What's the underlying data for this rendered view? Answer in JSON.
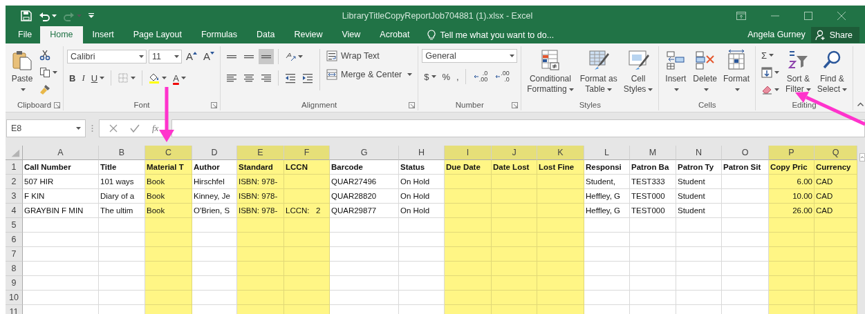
{
  "title_bar": {
    "title": "LibraryTitleCopyReportJob704881 (1).xlsx - Excel",
    "redo_disabled": true
  },
  "tabs": [
    {
      "label": "File",
      "selected": false
    },
    {
      "label": "Home",
      "selected": true
    },
    {
      "label": "Insert",
      "selected": false
    },
    {
      "label": "Page Layout",
      "selected": false
    },
    {
      "label": "Formulas",
      "selected": false
    },
    {
      "label": "Data",
      "selected": false
    },
    {
      "label": "Review",
      "selected": false
    },
    {
      "label": "View",
      "selected": false
    },
    {
      "label": "Acrobat",
      "selected": false
    }
  ],
  "tell_me": {
    "placeholder": "Tell me what you want to do..."
  },
  "user": "Angela Gurney",
  "share": "Share",
  "ribbon": {
    "groups": [
      {
        "label": "Clipboard",
        "launcher": true,
        "items": [
          {
            "kind": "large",
            "lines": [
              "Paste"
            ],
            "dropdown": true
          },
          {
            "kind": "stack",
            "items": [
              {
                "kind": "small",
                "dropdown": false
              },
              {
                "kind": "small",
                "dropdown": true
              },
              {
                "kind": "small",
                "dropdown": false
              }
            ]
          }
        ]
      },
      {
        "label": "Font",
        "launcher": true,
        "items": [
          {
            "kind": "rows",
            "lines": [
              {
                "items": [
                  {
                    "kind": "font-combo",
                    "value": "Calibri"
                  },
                  {
                    "kind": "size-combo",
                    "value": "11"
                  },
                  {
                    "kind": "grow",
                    "text": "A"
                  },
                  {
                    "kind": "shrink",
                    "text": "A"
                  }
                ]
              },
              {
                "items": [
                  {
                    "kind": "bold",
                    "text": "B",
                    "dropdown": false
                  },
                  {
                    "kind": "italic",
                    "text": "I",
                    "dropdown": false
                  },
                  {
                    "kind": "underline",
                    "text": "U",
                    "dropdown": true
                  },
                  {
                    "kind": "separator"
                  },
                  {
                    "kind": "small",
                    "dropdown": true
                  },
                  {
                    "kind": "separator"
                  },
                  {
                    "kind": "small",
                    "dropdown": true
                  },
                  {
                    "kind": "font-color",
                    "text": "A",
                    "dropdown": true
                  }
                ]
              }
            ]
          }
        ]
      },
      {
        "label": "Alignment",
        "launcher": true,
        "items": [
          {
            "kind": "rows",
            "lines": [
              {
                "items": [
                  {
                    "kind": "small",
                    "dropdown": false,
                    "selected": false
                  },
                  {
                    "kind": "small",
                    "dropdown": false,
                    "selected": false
                  },
                  {
                    "kind": "small",
                    "dropdown": false,
                    "selected": true
                  },
                  {
                    "kind": "separator"
                  },
                  {
                    "kind": "small",
                    "dropdown": true
                  }
                ]
              },
              {
                "items": [
                  {
                    "kind": "small",
                    "dropdown": false,
                    "selected": false
                  },
                  {
                    "kind": "small",
                    "dropdown": false,
                    "selected": false
                  },
                  {
                    "kind": "small",
                    "dropdown": false,
                    "selected": false
                  },
                  {
                    "kind": "separator"
                  },
                  {
                    "kind": "small",
                    "dropdown": false
                  },
                  {
                    "kind": "small",
                    "dropdown": false
                  }
                ]
              }
            ]
          },
          {
            "kind": "separator"
          },
          {
            "kind": "stack",
            "items": [
              {
                "kind": "text-button",
                "text": "Wrap Text",
                "dropdown": false
              },
              {
                "kind": "text-button",
                "text": "Merge & Center",
                "dropdown": true
              }
            ]
          }
        ]
      },
      {
        "label": "Number",
        "launcher": true,
        "items": [
          {
            "kind": "rows",
            "lines": [
              {
                "items": [
                  {
                    "kind": "format-combo",
                    "value": "General"
                  }
                ]
              },
              {
                "items": [
                  {
                    "kind": "text",
                    "text": "$",
                    "dropdown": true
                  },
                  {
                    "kind": "text",
                    "text": "%",
                    "dropdown": false
                  },
                  {
                    "kind": "text",
                    "text": ",",
                    "dropdown": false
                  },
                  {
                    "kind": "separator"
                  },
                  {
                    "kind": "decimal",
                    "lines": [
                      ".0",
                      ".00"
                    ]
                  },
                  {
                    "kind": "decimal",
                    "lines": [
                      ".00",
                      ".0"
                    ]
                  }
                ]
              }
            ]
          }
        ]
      },
      {
        "label": "Styles",
        "launcher": false,
        "items": [
          {
            "kind": "large",
            "lines": [
              "Conditional",
              "Formatting"
            ],
            "dropdown": true
          },
          {
            "kind": "large",
            "lines": [
              "Format as",
              "Table"
            ],
            "dropdown": true
          },
          {
            "kind": "large",
            "lines": [
              "Cell",
              "Styles"
            ],
            "dropdown": true
          }
        ]
      },
      {
        "label": "Cells",
        "launcher": false,
        "items": [
          {
            "kind": "large",
            "lines": [
              "Insert"
            ],
            "dropdown": true
          },
          {
            "kind": "large",
            "lines": [
              "Delete"
            ],
            "dropdown": true
          },
          {
            "kind": "large",
            "lines": [
              "Format"
            ],
            "dropdown": true
          }
        ]
      },
      {
        "label": "Editing",
        "launcher": false,
        "items": [
          {
            "kind": "stack",
            "items": [
              {
                "kind": "text",
                "text": "Σ",
                "dropdown": true
              },
              {
                "kind": "small",
                "dropdown": true
              },
              {
                "kind": "small",
                "dropdown": true
              }
            ]
          },
          {
            "kind": "large",
            "lines": [
              "Sort &",
              "Filter"
            ],
            "dropdown": true
          },
          {
            "kind": "large",
            "lines": [
              "Find &",
              "Select"
            ],
            "dropdown": true
          }
        ]
      }
    ]
  },
  "formula_bar": {
    "name_box": "E8",
    "function_label": "fx"
  },
  "sheet": {
    "columns": [
      {
        "letter": "A",
        "highlighted": false
      },
      {
        "letter": "B",
        "highlighted": false
      },
      {
        "letter": "C",
        "highlighted": true
      },
      {
        "letter": "D",
        "highlighted": false
      },
      {
        "letter": "E",
        "highlighted": true
      },
      {
        "letter": "F",
        "highlighted": true
      },
      {
        "letter": "G",
        "highlighted": false
      },
      {
        "letter": "H",
        "highlighted": false
      },
      {
        "letter": "I",
        "highlighted": true
      },
      {
        "letter": "J",
        "highlighted": true
      },
      {
        "letter": "K",
        "highlighted": true
      },
      {
        "letter": "L",
        "highlighted": false
      },
      {
        "letter": "M",
        "highlighted": false
      },
      {
        "letter": "N",
        "highlighted": false
      },
      {
        "letter": "O",
        "highlighted": false
      },
      {
        "letter": "P",
        "highlighted": true,
        "numeric": true
      },
      {
        "letter": "Q",
        "highlighted": true
      }
    ],
    "rows": [
      {
        "number": "1",
        "header": true,
        "cells": {
          "A": "Call Number",
          "B": "Title",
          "C": "Material T",
          "D": "Author",
          "E": "Standard",
          "F": "LCCN",
          "G": "Barcode",
          "H": "Status",
          "I": "Due Date",
          "J": "Date Lost",
          "K": "Lost Fine",
          "L": "Responsi",
          "M": "Patron Ba",
          "N": "Patron Ty",
          "O": "Patron Sit",
          "P": "Copy Pric",
          "Q": "Currency"
        }
      },
      {
        "number": "2",
        "header": false,
        "cells": {
          "A": "507 HIR",
          "B": "101 ways",
          "C": "Book",
          "D": "Hirschfel",
          "E": "ISBN: 978-",
          "G": "QUAR27496",
          "H": "On Hold",
          "L": "Student,",
          "M": "TEST333",
          "N": "Student",
          "P": "6.00",
          "Q": "CAD"
        }
      },
      {
        "number": "3",
        "header": false,
        "cells": {
          "A": "F KIN",
          "B": "Diary of a",
          "C": "Book",
          "D": "Kinney, Je",
          "E": "ISBN: 978-",
          "G": "QUAR28820",
          "H": "On Hold",
          "L": "Heffley, G",
          "M": "TEST000",
          "N": "Student",
          "P": "10.00",
          "Q": "CAD"
        }
      },
      {
        "number": "4",
        "header": false,
        "cells": {
          "A": "GRAYBIN F MIN",
          "B": "The ultim",
          "C": "Book",
          "D": "O'Brien, S",
          "E": "ISBN: 978-",
          "F": "LCCN:   2",
          "G": "QUAR29877",
          "H": "On Hold",
          "L": "Heffley, G",
          "M": "TEST000",
          "N": "Student",
          "P": "26.00",
          "Q": "CAD"
        }
      },
      {
        "number": "5",
        "header": false
      },
      {
        "number": "6",
        "header": false
      },
      {
        "number": "7",
        "header": false
      },
      {
        "number": "8",
        "header": false
      },
      {
        "number": "9",
        "header": false
      },
      {
        "number": "10",
        "header": false
      },
      {
        "number": "11",
        "header": false
      }
    ]
  }
}
